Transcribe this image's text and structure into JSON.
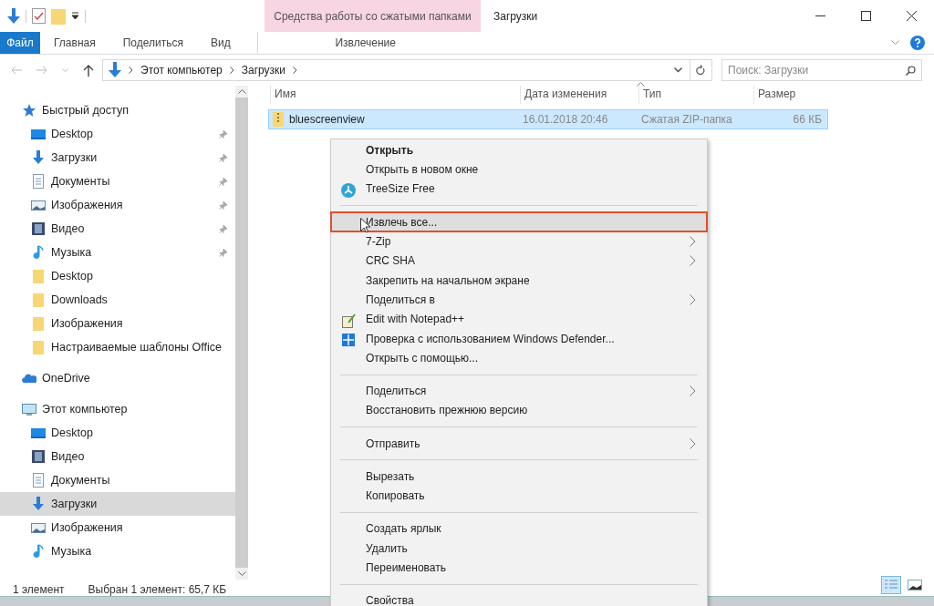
{
  "title_bar": {
    "context_group": "Средства работы со сжатыми папками",
    "title": "Загрузки"
  },
  "ribbon_tabs": [
    {
      "label": "Файл",
      "kind": "file"
    },
    {
      "label": "Главная",
      "kind": "tab"
    },
    {
      "label": "Поделиться",
      "kind": "tab"
    },
    {
      "label": "Вид",
      "kind": "tab"
    },
    {
      "label": "Извлечение",
      "kind": "context"
    }
  ],
  "address_bar": {
    "path": [
      "Этот компьютер",
      "Загрузки"
    ]
  },
  "search": {
    "placeholder": "Поиск: Загрузки"
  },
  "columns": [
    "Имя",
    "Дата изменения",
    "Тип",
    "Размер"
  ],
  "rows": [
    {
      "name": "bluescreenview",
      "date": "16.01.2018 20:46",
      "type": "Сжатая ZIP-папка",
      "size": "66 КБ",
      "selected": true
    }
  ],
  "navigation": [
    {
      "label": "Быстрый доступ",
      "kind": "star",
      "children": [
        {
          "label": "Desktop",
          "kind": "desktop",
          "pinned": true,
          "selected": false
        },
        {
          "label": "Загрузки",
          "kind": "downloads",
          "pinned": true,
          "selected": false
        },
        {
          "label": "Документы",
          "kind": "documents",
          "pinned": true,
          "selected": false
        },
        {
          "label": "Изображения",
          "kind": "pictures",
          "pinned": true,
          "selected": false
        },
        {
          "label": "Видео",
          "kind": "video",
          "pinned": true,
          "selected": false
        },
        {
          "label": "Музыка",
          "kind": "music",
          "pinned": true,
          "selected": false
        },
        {
          "label": "Desktop",
          "kind": "folder",
          "pinned": false,
          "selected": false
        },
        {
          "label": "Downloads",
          "kind": "folder",
          "pinned": false,
          "selected": false
        },
        {
          "label": "Изображения",
          "kind": "folder",
          "pinned": false,
          "selected": false
        },
        {
          "label": "Настраиваемые шаблоны Office",
          "kind": "folder",
          "pinned": false,
          "selected": false
        }
      ]
    },
    {
      "label": "OneDrive",
      "kind": "cloud"
    },
    {
      "label": "Этот компьютер",
      "kind": "computer",
      "children": [
        {
          "label": "Desktop",
          "kind": "desktop",
          "pinned": false,
          "selected": false
        },
        {
          "label": "Видео",
          "kind": "video",
          "pinned": false,
          "selected": false
        },
        {
          "label": "Документы",
          "kind": "documents",
          "pinned": false,
          "selected": false
        },
        {
          "label": "Загрузки",
          "kind": "downloads",
          "pinned": false,
          "selected": true
        },
        {
          "label": "Изображения",
          "kind": "pictures",
          "pinned": false,
          "selected": false
        },
        {
          "label": "Музыка",
          "kind": "music",
          "pinned": false,
          "selected": false
        }
      ]
    }
  ],
  "status_bar": {
    "count": "1 элемент",
    "selection": "Выбран 1 элемент: 65,7 КБ"
  },
  "view_buttons": [
    {
      "kind": "details",
      "selected": true
    },
    {
      "kind": "tiles",
      "selected": false
    }
  ],
  "context_menu": [
    {
      "kind": "item",
      "label": "Открыть",
      "bold": true,
      "submenu": false,
      "highlighted": false
    },
    {
      "kind": "item",
      "label": "Открыть в новом окне",
      "bold": false,
      "submenu": false,
      "highlighted": false
    },
    {
      "kind": "treesize",
      "label": "TreeSize Free",
      "bold": false,
      "submenu": false,
      "highlighted": false
    },
    {
      "kind": "separator"
    },
    {
      "kind": "item",
      "label": "Извлечь все...",
      "bold": false,
      "submenu": false,
      "highlighted": true
    },
    {
      "kind": "item",
      "label": "7-Zip",
      "bold": false,
      "submenu": true,
      "highlighted": false
    },
    {
      "kind": "item",
      "label": "CRC SHA",
      "bold": false,
      "submenu": true,
      "highlighted": false
    },
    {
      "kind": "item",
      "label": "Закрепить на начальном экране",
      "bold": false,
      "submenu": false,
      "highlighted": false
    },
    {
      "kind": "item",
      "label": "Поделиться в",
      "bold": false,
      "submenu": true,
      "highlighted": false
    },
    {
      "kind": "notepad",
      "label": "Edit with Notepad++",
      "bold": false,
      "submenu": false,
      "highlighted": false
    },
    {
      "kind": "defender",
      "label": "Проверка с использованием Windows Defender...",
      "bold": false,
      "submenu": false,
      "highlighted": false
    },
    {
      "kind": "item",
      "label": "Открыть с помощью...",
      "bold": false,
      "submenu": false,
      "highlighted": false
    },
    {
      "kind": "separator"
    },
    {
      "kind": "item",
      "label": "Поделиться",
      "bold": false,
      "submenu": true,
      "highlighted": false
    },
    {
      "kind": "item",
      "label": "Восстановить прежнюю версию",
      "bold": false,
      "submenu": false,
      "highlighted": false
    },
    {
      "kind": "separator"
    },
    {
      "kind": "item",
      "label": "Отправить",
      "bold": false,
      "submenu": true,
      "highlighted": false
    },
    {
      "kind": "separator"
    },
    {
      "kind": "item",
      "label": "Вырезать",
      "bold": false,
      "submenu": false,
      "highlighted": false
    },
    {
      "kind": "item",
      "label": "Копировать",
      "bold": false,
      "submenu": false,
      "highlighted": false
    },
    {
      "kind": "separator"
    },
    {
      "kind": "item",
      "label": "Создать ярлык",
      "bold": false,
      "submenu": false,
      "highlighted": false
    },
    {
      "kind": "item",
      "label": "Удалить",
      "bold": false,
      "submenu": false,
      "highlighted": false
    },
    {
      "kind": "item",
      "label": "Переименовать",
      "bold": false,
      "submenu": false,
      "highlighted": false
    },
    {
      "kind": "separator"
    },
    {
      "kind": "item",
      "label": "Свойства",
      "bold": false,
      "submenu": false,
      "highlighted": false
    }
  ]
}
